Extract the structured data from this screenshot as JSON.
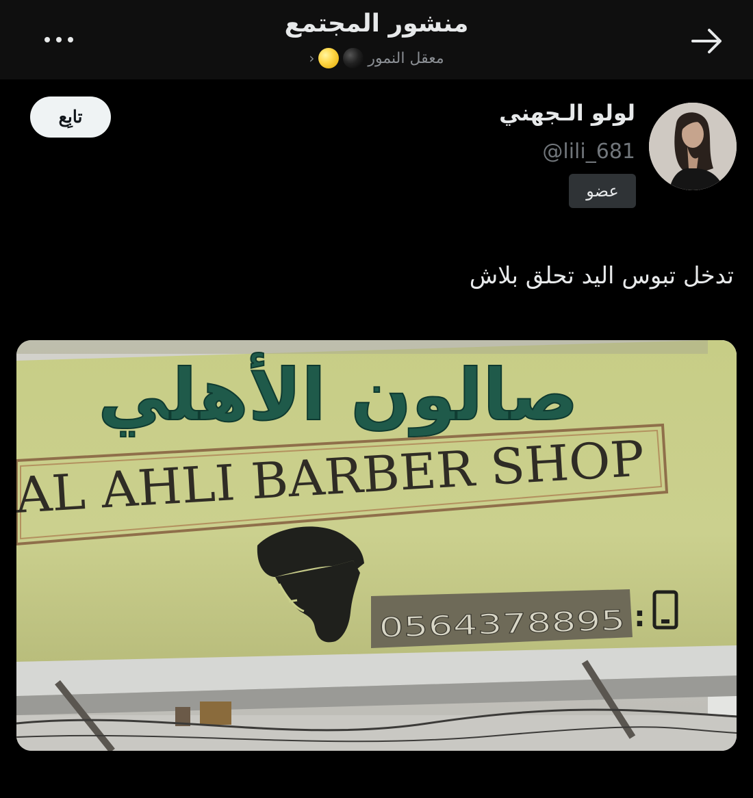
{
  "header": {
    "title": "منشور المجتمع",
    "subtitle": "معقل النمور",
    "subtitle_chevron": "‹",
    "more_icon": "more-horizontal-icon",
    "back_icon": "arrow-right-icon",
    "community_balls": [
      "black",
      "yellow"
    ]
  },
  "post": {
    "author_name": "لولو الـجهني",
    "author_handle": "@lili_681",
    "role_badge": "عضو",
    "follow_label": "تابِع",
    "text": "تدخل تبوس اليد تحلق بلاش"
  },
  "media": {
    "sign_arabic": "صالون الأهلي",
    "sign_english": "AL AHLI BARBER SHOP",
    "sign_phone": "0564378895",
    "sign_phone_sep": ":",
    "sign_phone_icon": "mobile-phone-icon",
    "sign_color": "#c9cf8a"
  },
  "colors": {
    "background": "#000000",
    "header_bg": "#0f0f0f",
    "text_primary": "#e7e9ea",
    "text_secondary": "#71767b",
    "follow_bg": "#eff3f4",
    "badge_bg": "#2f3336",
    "sign_green": "#1f5a4a"
  }
}
